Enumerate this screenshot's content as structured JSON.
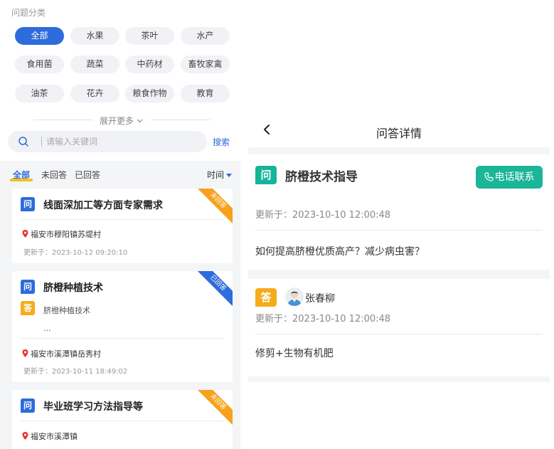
{
  "category": {
    "title": "问题分类",
    "items": [
      "全部",
      "水果",
      "茶叶",
      "水产",
      "食用菌",
      "蔬菜",
      "中药材",
      "畜牧家禽",
      "油茶",
      "花卉",
      "粮食作物",
      "教育"
    ],
    "expand_label": "展开更多"
  },
  "search": {
    "placeholder": "请输入关键词",
    "button": "搜索"
  },
  "tabs": [
    "全部",
    "未回答",
    "已回答"
  ],
  "sort_label": "时间",
  "cards": [
    {
      "q_badge": "问",
      "title": "线面深加工等方面专家需求",
      "ribbon": "未回答",
      "location": "福安市穆阳镇苏堤村",
      "updated": "更新于：2023-10-12 09:20:10"
    },
    {
      "q_badge": "问",
      "title": "脐橙种植技术",
      "ribbon": "已回答",
      "a_badge": "答",
      "answer": "脐橙种植技术",
      "ellipsis": "...",
      "location": "福安市溪潭镇岳秀村",
      "updated": "更新于：2023-10-11 18:49:02"
    },
    {
      "q_badge": "问",
      "title": "毕业班学习方法指导等",
      "ribbon": "未回答",
      "location": "福安市溪潭镇"
    }
  ],
  "detail": {
    "nav_title": "问答详情",
    "q_badge": "问",
    "title": "脐橙技术指导",
    "call_button": "电话联系",
    "updated": "更新于：2023-10-10 12:00:48",
    "question": "如何提高脐橙优质高产？减少病虫害？",
    "a_badge": "答",
    "answerer": "张春柳",
    "answer_updated": "更新于：2023-10-10 12:00:48",
    "answer": "修剪+生物有机肥"
  },
  "colors": {
    "primary": "#2e6bdc",
    "teal": "#16b59a",
    "orange": "#f6ab1a",
    "highlight": "#f6c21a"
  }
}
